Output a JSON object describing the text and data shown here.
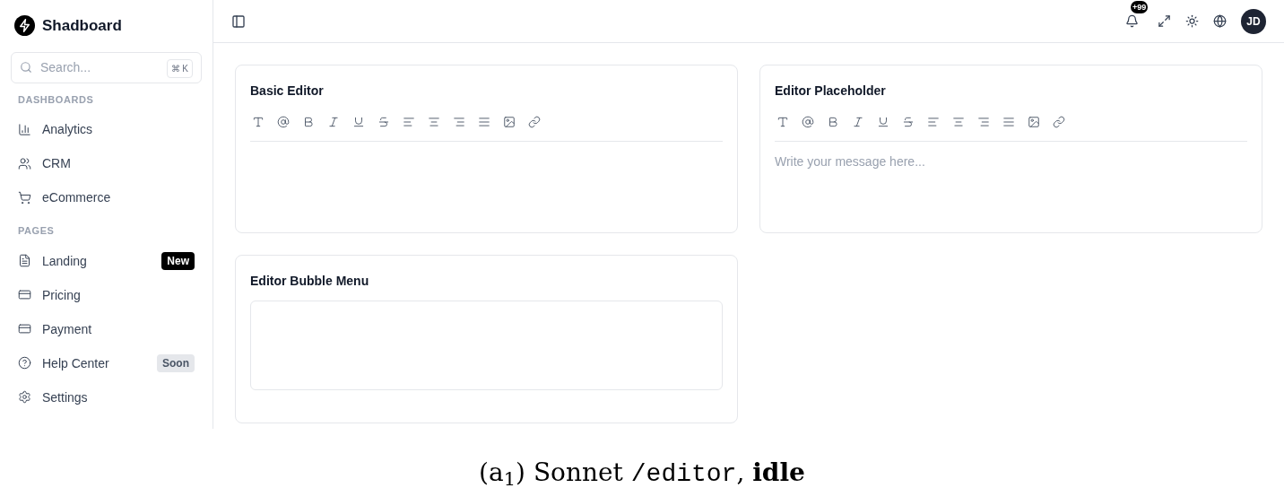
{
  "brand": {
    "name": "Shadboard"
  },
  "search": {
    "placeholder": "Search...",
    "shortcut": "⌘ K"
  },
  "sidebar": {
    "sections": [
      {
        "title": "DASHBOARDS",
        "items": [
          {
            "label": "Analytics"
          },
          {
            "label": "CRM"
          },
          {
            "label": "eCommerce"
          }
        ]
      },
      {
        "title": "PAGES",
        "items": [
          {
            "label": "Landing",
            "badge": {
              "text": "New",
              "kind": "dark"
            }
          },
          {
            "label": "Pricing"
          },
          {
            "label": "Payment"
          },
          {
            "label": "Help Center",
            "badge": {
              "text": "Soon",
              "kind": "muted"
            }
          },
          {
            "label": "Settings"
          }
        ]
      }
    ]
  },
  "header": {
    "notifications": "+99",
    "avatar": "JD"
  },
  "editors": [
    {
      "title": "Basic Editor",
      "kind": "toolbar"
    },
    {
      "title": "Editor Placeholder",
      "kind": "toolbar",
      "placeholder": "Write your message here..."
    },
    {
      "title": "Editor Bubble Menu",
      "kind": "bubble"
    }
  ],
  "caption": {
    "prefix": "(a$_{1}$) Sonnet",
    "code": "/editor",
    "suffix": ", **idle**"
  }
}
